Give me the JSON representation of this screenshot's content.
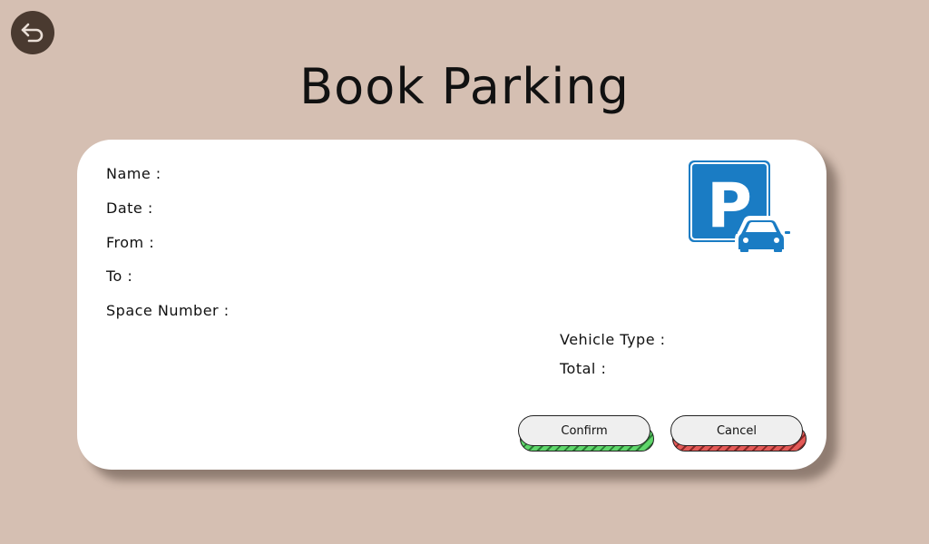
{
  "page": {
    "title": "Book Parking",
    "back_icon": "back-arrow-icon"
  },
  "form": {
    "name_label": "Name :",
    "date_label": "Date :",
    "from_label": "From :",
    "to_label": "To :",
    "space_number_label": "Space Number :",
    "vehicle_type_label": "Vehicle Type :",
    "total_label": "Total :",
    "parking_icon": "parking-sign-icon",
    "parking_sign_letter": "P"
  },
  "actions": {
    "confirm_label": "Confirm",
    "cancel_label": "Cancel"
  },
  "colors": {
    "background": "#d5bfb2",
    "back_button": "#4a3a30",
    "parking_blue": "#1a7cc4",
    "confirm_accent": "#5fd66b",
    "cancel_accent": "#e35a57"
  }
}
